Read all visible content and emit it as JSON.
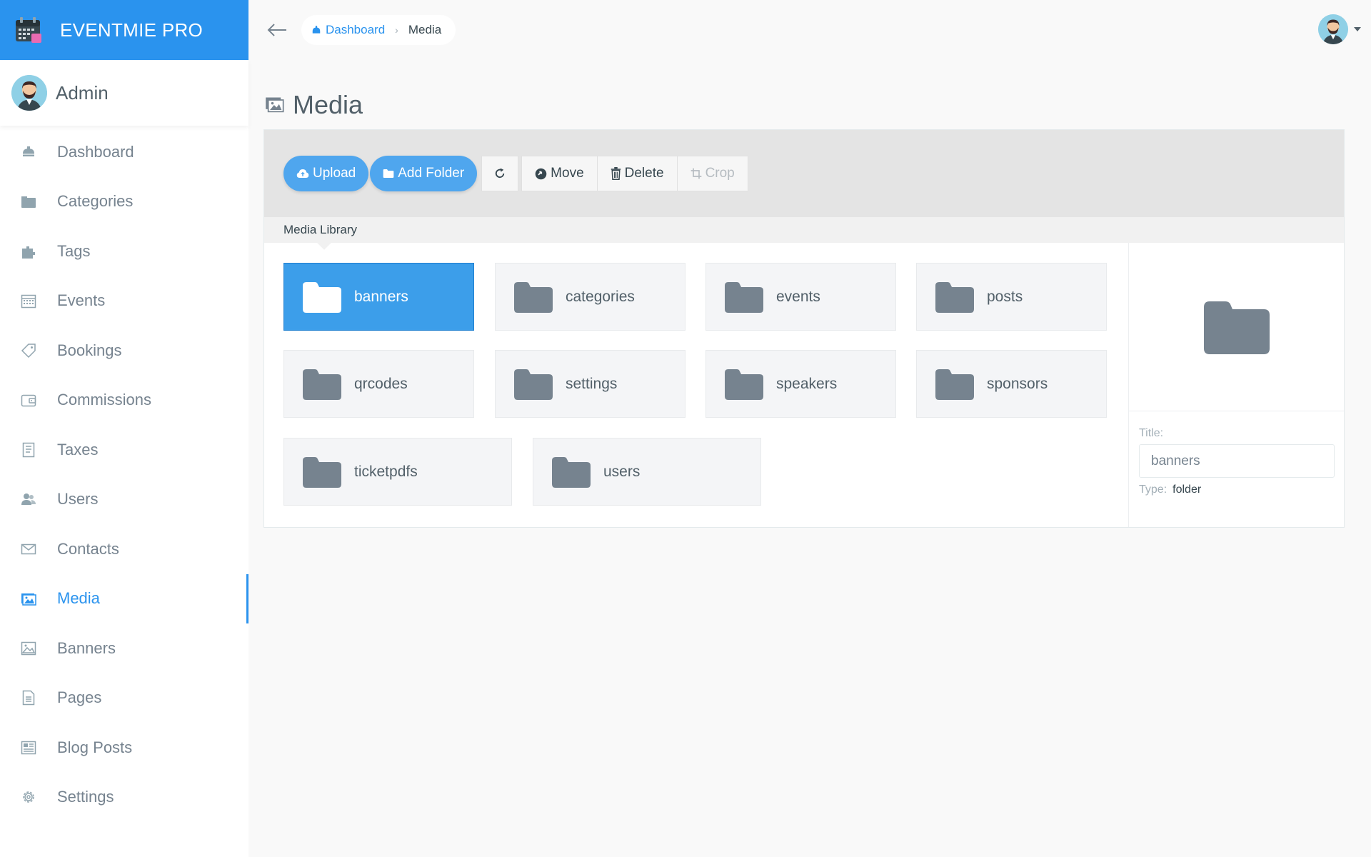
{
  "brand": {
    "name": "EVENTMIE PRO",
    "color": "#2a93ee"
  },
  "profile": {
    "name": "Admin"
  },
  "sidebar": {
    "items": [
      {
        "label": "Dashboard",
        "icon": "dashboard-icon"
      },
      {
        "label": "Categories",
        "icon": "categories-icon"
      },
      {
        "label": "Tags",
        "icon": "tags-icon"
      },
      {
        "label": "Events",
        "icon": "calendar-icon"
      },
      {
        "label": "Bookings",
        "icon": "ticket-icon"
      },
      {
        "label": "Commissions",
        "icon": "wallet-icon"
      },
      {
        "label": "Taxes",
        "icon": "document-icon"
      },
      {
        "label": "Users",
        "icon": "users-icon"
      },
      {
        "label": "Contacts",
        "icon": "envelope-icon"
      },
      {
        "label": "Media",
        "icon": "images-icon",
        "active": true
      },
      {
        "label": "Banners",
        "icon": "image-icon"
      },
      {
        "label": "Pages",
        "icon": "page-icon"
      },
      {
        "label": "Blog Posts",
        "icon": "newspaper-icon"
      },
      {
        "label": "Settings",
        "icon": "gear-icon"
      }
    ]
  },
  "breadcrumb": {
    "home": "Dashboard",
    "current": "Media"
  },
  "page": {
    "title": "Media"
  },
  "toolbar": {
    "upload": "Upload",
    "add_folder": "Add Folder",
    "move": "Move",
    "delete": "Delete",
    "crop": "Crop"
  },
  "library": {
    "label": "Media Library",
    "folders": [
      "banners",
      "categories",
      "events",
      "posts",
      "qrcodes",
      "settings",
      "speakers",
      "sponsors",
      "ticketpdfs",
      "users"
    ],
    "selected": "banners"
  },
  "details": {
    "title_label": "Title:",
    "title_value": "banners",
    "type_label": "Type:",
    "type_value": "folder"
  },
  "colors": {
    "accent": "#2a93ee",
    "folder": "#76838f",
    "selected_tile": "#3c9eea"
  }
}
